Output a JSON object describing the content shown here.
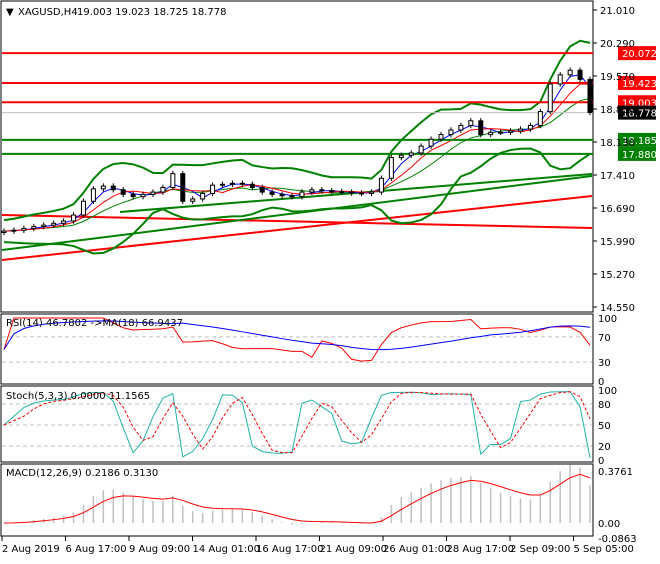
{
  "header": {
    "symbol": "XAGUSD,H4",
    "ohlc": "19.003 19.023 18.725 18.778"
  },
  "colors": {
    "bull": "#000000",
    "bear": "#000000",
    "resistance": "#ff0000",
    "support": "#008000",
    "rsi": "#ff0000",
    "rsi_ma": "#0000ff",
    "stoch_main": "#20b2aa",
    "stoch_signal": "#ff0000",
    "macd_hist": "#c0c0c0",
    "macd_signal": "#ff0000"
  },
  "chart_data": [
    {
      "type": "candlestick",
      "title": "XAGUSD,H4",
      "x_tick_labels": [
        "2 Aug 2019",
        "6 Aug 17:00",
        "9 Aug 09:00",
        "14 Aug 01:00",
        "16 Aug 17:00",
        "21 Aug 09:00",
        "26 Aug 01:00",
        "28 Aug 17:00",
        "2 Sep 09:00",
        "5 Sep 05:00"
      ],
      "y_tick_labels": [
        "21.010",
        "20.290",
        "19.570",
        "18.850",
        "18.130",
        "17.410",
        "16.690",
        "15.990",
        "15.270",
        "14.550"
      ],
      "ylim": [
        14.55,
        21.01
      ],
      "close": [
        16.2,
        16.22,
        16.26,
        16.3,
        16.33,
        16.37,
        16.42,
        16.55,
        16.85,
        17.12,
        17.18,
        17.1,
        17.0,
        16.95,
        17.0,
        17.05,
        17.15,
        17.45,
        16.85,
        16.9,
        17.02,
        17.2,
        17.22,
        17.24,
        17.22,
        17.15,
        17.05,
        17.0,
        16.97,
        16.95,
        17.05,
        17.1,
        17.08,
        17.06,
        17.05,
        17.03,
        17.02,
        17.05,
        17.35,
        17.8,
        17.85,
        17.9,
        18.05,
        18.2,
        18.3,
        18.4,
        18.5,
        18.6,
        18.3,
        18.35,
        18.35,
        18.38,
        18.42,
        18.5,
        18.8,
        19.4,
        19.6,
        19.7,
        19.5,
        18.78
      ],
      "levels": [
        {
          "label": "20.072",
          "value": 20.072,
          "kind": "resistance"
        },
        {
          "label": "19.423",
          "value": 19.423,
          "kind": "resistance"
        },
        {
          "label": "19.003",
          "value": 19.003,
          "kind": "resistance"
        },
        {
          "label": "18.778",
          "value": 18.778,
          "kind": "current"
        },
        {
          "label": "18.185",
          "value": 18.185,
          "kind": "support"
        },
        {
          "label": "17.880",
          "value": 17.88,
          "kind": "support"
        }
      ]
    },
    {
      "type": "line",
      "title": "RSI(14) 46.7802  ->MA(18) 66.9437",
      "y_tick_labels": [
        "100",
        "70",
        "30",
        "0"
      ],
      "ylim": [
        0,
        100
      ]
    },
    {
      "type": "line",
      "title": "Stoch(5,3,3) 0.0000 11.1565",
      "y_tick_labels": [
        "100",
        "80",
        "50",
        "20",
        "0"
      ],
      "ylim": [
        0,
        100
      ]
    },
    {
      "type": "bar",
      "title": "MACD(12,26,9) 0.2186 0.3130",
      "y_tick_labels": [
        "0.3761",
        "0.00",
        "-0.0863"
      ],
      "ylim": [
        -0.0863,
        0.3761
      ]
    }
  ]
}
